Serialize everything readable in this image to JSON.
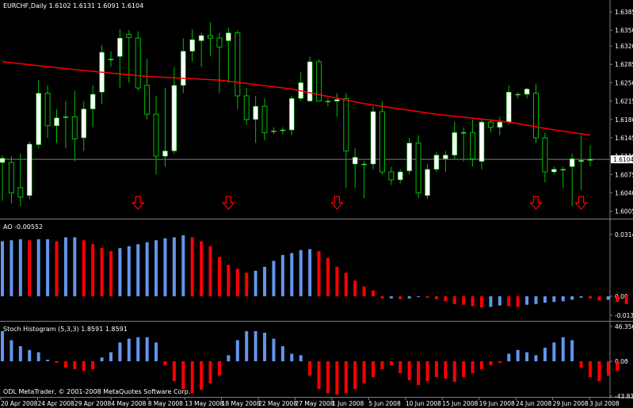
{
  "header": {
    "symbol_info": "EURCHF,Daily  1.6102 1.6131 1.6091 1.6104",
    "ao_title": "AO -0.00552",
    "stoch_title": "Stoch Histogram (5,3,3) 1.8591 1.8591",
    "copyright": "ODL MetaTrader, © 2001-2008 MetaQuotes Software Corp."
  },
  "colors": {
    "background": "#000000",
    "bull_candle": "#ffffff",
    "wick": "#00c000",
    "moving_average": "#ff0000",
    "signal_arrow": "#ff0000",
    "hist_up": "#6495ed",
    "hist_down": "#ff0000",
    "axis": "#808080",
    "current_price_line": "#808080"
  },
  "chart_data": [
    {
      "type": "candlestick",
      "pane": "price",
      "symbol": "EURCHF",
      "timeframe": "Daily",
      "ylim": [
        1.6,
        1.6385
      ],
      "y_ticks": [
        "1.6385",
        "1.6350",
        "1.6320",
        "1.6285",
        "1.6250",
        "1.6215",
        "1.6180",
        "1.6145",
        "1.6110",
        "1.6075",
        "1.6040",
        "1.6005"
      ],
      "current_price": "1.6104",
      "x_ticks": [
        "20 Apr 2008",
        "24 Apr 2008",
        "29 Apr 2008",
        "4 May 2008",
        "8 May 2008",
        "13 May 2008",
        "18 May 2008",
        "22 May 2008",
        "27 May 2008",
        "1 Jun 2008",
        "5 Jun 2008",
        "10 Jun 2008",
        "15 Jun 2008",
        "19 Jun 2008",
        "24 Jun 2008",
        "29 Jun 2008",
        "3 Jul 2008"
      ],
      "candles": [
        {
          "o": 1.6098,
          "h": 1.6112,
          "l": 1.6025,
          "c": 1.6106
        },
        {
          "o": 1.6098,
          "h": 1.611,
          "l": 1.602,
          "c": 1.604
        },
        {
          "o": 1.605,
          "h": 1.6115,
          "l": 1.6015,
          "c": 1.6032
        },
        {
          "o": 1.6035,
          "h": 1.6138,
          "l": 1.6028,
          "c": 1.6133
        },
        {
          "o": 1.6132,
          "h": 1.6255,
          "l": 1.6125,
          "c": 1.623
        },
        {
          "o": 1.623,
          "h": 1.6245,
          "l": 1.6145,
          "c": 1.6168
        },
        {
          "o": 1.6168,
          "h": 1.62,
          "l": 1.6135,
          "c": 1.6183
        },
        {
          "o": 1.6185,
          "h": 1.6215,
          "l": 1.6125,
          "c": 1.6185
        },
        {
          "o": 1.6185,
          "h": 1.6235,
          "l": 1.61,
          "c": 1.6143
        },
        {
          "o": 1.6145,
          "h": 1.6215,
          "l": 1.612,
          "c": 1.62
        },
        {
          "o": 1.62,
          "h": 1.6245,
          "l": 1.6165,
          "c": 1.6228
        },
        {
          "o": 1.6232,
          "h": 1.6322,
          "l": 1.621,
          "c": 1.6308
        },
        {
          "o": 1.6295,
          "h": 1.631,
          "l": 1.628,
          "c": 1.6295
        },
        {
          "o": 1.63,
          "h": 1.6352,
          "l": 1.624,
          "c": 1.6335
        },
        {
          "o": 1.6342,
          "h": 1.635,
          "l": 1.625,
          "c": 1.6336
        },
        {
          "o": 1.6335,
          "h": 1.6348,
          "l": 1.6235,
          "c": 1.624
        },
        {
          "o": 1.6245,
          "h": 1.6295,
          "l": 1.618,
          "c": 1.619
        },
        {
          "o": 1.619,
          "h": 1.6225,
          "l": 1.6075,
          "c": 1.611
        },
        {
          "o": 1.611,
          "h": 1.624,
          "l": 1.609,
          "c": 1.612
        },
        {
          "o": 1.612,
          "h": 1.628,
          "l": 1.6115,
          "c": 1.6245
        },
        {
          "o": 1.6245,
          "h": 1.6335,
          "l": 1.623,
          "c": 1.631
        },
        {
          "o": 1.631,
          "h": 1.6352,
          "l": 1.629,
          "c": 1.6332
        },
        {
          "o": 1.633,
          "h": 1.6345,
          "l": 1.628,
          "c": 1.634
        },
        {
          "o": 1.634,
          "h": 1.6365,
          "l": 1.63,
          "c": 1.6335
        },
        {
          "o": 1.6335,
          "h": 1.6345,
          "l": 1.623,
          "c": 1.6318
        },
        {
          "o": 1.633,
          "h": 1.6355,
          "l": 1.625,
          "c": 1.6345
        },
        {
          "o": 1.6345,
          "h": 1.635,
          "l": 1.62,
          "c": 1.6225
        },
        {
          "o": 1.6225,
          "h": 1.624,
          "l": 1.617,
          "c": 1.618
        },
        {
          "o": 1.618,
          "h": 1.6225,
          "l": 1.6135,
          "c": 1.6205
        },
        {
          "o": 1.6205,
          "h": 1.622,
          "l": 1.614,
          "c": 1.6155
        },
        {
          "o": 1.6158,
          "h": 1.6165,
          "l": 1.6152,
          "c": 1.6158
        },
        {
          "o": 1.616,
          "h": 1.6165,
          "l": 1.6152,
          "c": 1.616
        },
        {
          "o": 1.616,
          "h": 1.6225,
          "l": 1.615,
          "c": 1.622
        },
        {
          "o": 1.622,
          "h": 1.627,
          "l": 1.6215,
          "c": 1.625
        },
        {
          "o": 1.6215,
          "h": 1.63,
          "l": 1.6215,
          "c": 1.629
        },
        {
          "o": 1.629,
          "h": 1.6295,
          "l": 1.6215,
          "c": 1.6215
        },
        {
          "o": 1.6215,
          "h": 1.622,
          "l": 1.6205,
          "c": 1.6215
        },
        {
          "o": 1.6215,
          "h": 1.623,
          "l": 1.6185,
          "c": 1.6218
        },
        {
          "o": 1.622,
          "h": 1.623,
          "l": 1.605,
          "c": 1.612
        },
        {
          "o": 1.6095,
          "h": 1.6125,
          "l": 1.605,
          "c": 1.6108
        },
        {
          "o": 1.6095,
          "h": 1.61,
          "l": 1.603,
          "c": 1.6095
        },
        {
          "o": 1.6095,
          "h": 1.6205,
          "l": 1.6085,
          "c": 1.6195
        },
        {
          "o": 1.6195,
          "h": 1.6215,
          "l": 1.6075,
          "c": 1.608
        },
        {
          "o": 1.608,
          "h": 1.609,
          "l": 1.6055,
          "c": 1.6065
        },
        {
          "o": 1.6065,
          "h": 1.6085,
          "l": 1.6058,
          "c": 1.608
        },
        {
          "o": 1.6082,
          "h": 1.6145,
          "l": 1.6075,
          "c": 1.6135
        },
        {
          "o": 1.6135,
          "h": 1.615,
          "l": 1.603,
          "c": 1.604
        },
        {
          "o": 1.6035,
          "h": 1.6095,
          "l": 1.6028,
          "c": 1.6085
        },
        {
          "o": 1.6085,
          "h": 1.6118,
          "l": 1.608,
          "c": 1.6112
        },
        {
          "o": 1.6105,
          "h": 1.612,
          "l": 1.608,
          "c": 1.6112
        },
        {
          "o": 1.6112,
          "h": 1.6175,
          "l": 1.6105,
          "c": 1.6155
        },
        {
          "o": 1.6155,
          "h": 1.6165,
          "l": 1.61,
          "c": 1.6155
        },
        {
          "o": 1.6155,
          "h": 1.618,
          "l": 1.609,
          "c": 1.6105
        },
        {
          "o": 1.61,
          "h": 1.618,
          "l": 1.6085,
          "c": 1.6175
        },
        {
          "o": 1.6175,
          "h": 1.618,
          "l": 1.6155,
          "c": 1.6165
        },
        {
          "o": 1.6165,
          "h": 1.6185,
          "l": 1.615,
          "c": 1.6175
        },
        {
          "o": 1.6175,
          "h": 1.6245,
          "l": 1.617,
          "c": 1.6232
        },
        {
          "o": 1.6228,
          "h": 1.6232,
          "l": 1.622,
          "c": 1.6228
        },
        {
          "o": 1.6228,
          "h": 1.624,
          "l": 1.622,
          "c": 1.6238
        },
        {
          "o": 1.623,
          "h": 1.6248,
          "l": 1.6135,
          "c": 1.6145
        },
        {
          "o": 1.6145,
          "h": 1.6155,
          "l": 1.606,
          "c": 1.608
        },
        {
          "o": 1.608,
          "h": 1.609,
          "l": 1.6075,
          "c": 1.6085
        },
        {
          "o": 1.6085,
          "h": 1.609,
          "l": 1.605,
          "c": 1.6085
        },
        {
          "o": 1.609,
          "h": 1.6115,
          "l": 1.6015,
          "c": 1.6105
        },
        {
          "o": 1.61,
          "h": 1.615,
          "l": 1.6045,
          "c": 1.6102
        },
        {
          "o": 1.6102,
          "h": 1.6131,
          "l": 1.6091,
          "c": 1.6104
        }
      ],
      "moving_average": [
        [
          0,
          1.629
        ],
        [
          8,
          1.6275
        ],
        [
          16,
          1.6262
        ],
        [
          24,
          1.6255
        ],
        [
          32,
          1.6238
        ],
        [
          40,
          1.621
        ],
        [
          48,
          1.619
        ],
        [
          56,
          1.6175
        ],
        [
          61,
          1.616
        ],
        [
          65,
          1.615
        ]
      ],
      "signal_arrows": [
        15,
        25,
        37,
        59,
        64
      ]
    },
    {
      "type": "bar",
      "pane": "AO",
      "title": "AO -0.00552",
      "ylim": [
        -0.01343,
        0.03143
      ],
      "y_ticks": [
        "0.03143",
        "0.00",
        "-0.01343"
      ],
      "values": [
        0.028,
        0.0285,
        0.029,
        0.0285,
        0.029,
        0.029,
        0.028,
        0.03,
        0.03,
        0.0285,
        0.0265,
        0.0245,
        0.023,
        0.0245,
        0.0255,
        0.0265,
        0.0275,
        0.0285,
        0.0295,
        0.03,
        0.031,
        0.03,
        0.028,
        0.0255,
        0.02,
        0.016,
        0.014,
        0.012,
        0.013,
        0.015,
        0.018,
        0.021,
        0.022,
        0.0235,
        0.024,
        0.023,
        0.0195,
        0.015,
        0.012,
        0.008,
        0.005,
        0.003,
        -0.0015,
        -0.0015,
        -0.002,
        -0.0015,
        -0.0005,
        -0.001,
        -0.002,
        -0.0035,
        -0.0055,
        -0.006,
        -0.007,
        -0.008,
        -0.0075,
        -0.0065,
        -0.007,
        -0.0075,
        -0.006,
        -0.0055,
        -0.0045,
        -0.004,
        -0.0035,
        -0.0025,
        -0.001,
        -0.0015,
        -0.003,
        -0.0025,
        -0.004,
        -0.0055
      ]
    },
    {
      "type": "bar",
      "pane": "Stoch Histogram",
      "title": "Stoch Histogram (5,3,3) 1.8591 1.8591",
      "ylim": [
        -43.8341,
        46.3568
      ],
      "y_ticks": [
        "46.3568",
        "0.00",
        "-43.8341"
      ],
      "values": [
        40.0,
        28.0,
        20.0,
        15.0,
        12.0,
        2.0,
        -2.0,
        -8.0,
        -10.0,
        -12.0,
        -10.0,
        5.0,
        12.0,
        25.0,
        30.0,
        32.0,
        32.0,
        25.0,
        -5.0,
        -25.0,
        -35.0,
        -40.0,
        -36.0,
        -28.0,
        -18.0,
        8.0,
        28.0,
        40.0,
        40.0,
        38.0,
        30.0,
        20.0,
        10.0,
        8.0,
        -18.0,
        -35.0,
        -40.0,
        -42.0,
        -40.0,
        -35.0,
        -28.0,
        -20.0,
        -10.0,
        -5.0,
        -15.0,
        -24.0,
        -30.0,
        -25.0,
        -20.0,
        -22.0,
        -26.0,
        -20.0,
        -15.0,
        -10.0,
        -5.0,
        -2.0,
        10.0,
        15.0,
        12.0,
        8.0,
        18.0,
        25.0,
        32.0,
        28.0,
        -8.0,
        -20.0,
        -25.0,
        -18.0,
        -12.0,
        1.86
      ]
    }
  ]
}
